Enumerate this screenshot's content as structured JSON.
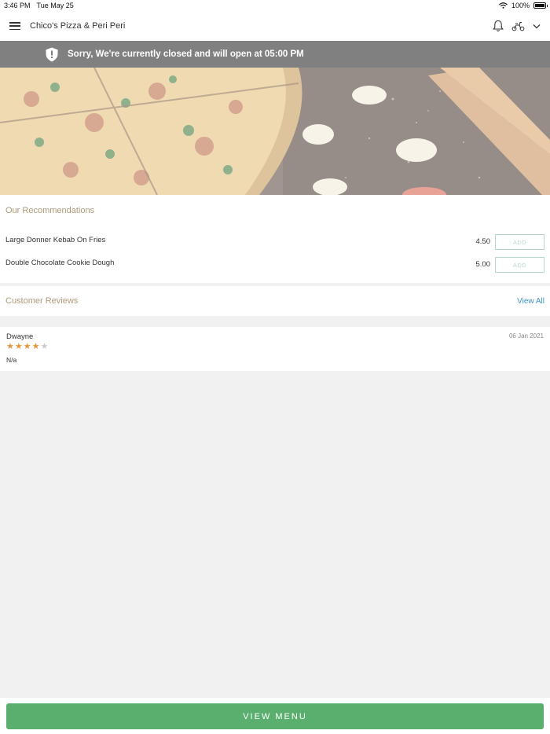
{
  "status_bar": {
    "time": "3:46 PM",
    "date": "Tue May 25",
    "battery": "100%"
  },
  "header": {
    "title": "Chico's Pizza & Peri Peri",
    "icons": [
      "menu-icon",
      "bell-icon",
      "delivery-scooter-icon",
      "chevron-down-icon"
    ]
  },
  "banner": {
    "message": "Sorry, We're currently closed and will open at 05:00 PM",
    "icon": "shield-alert-icon",
    "color": "#808080"
  },
  "recommendations": {
    "title": "Our Recommendations",
    "items": [
      {
        "name": "Large Donner Kebab On Fries",
        "price": "4.50",
        "button": "ADD"
      },
      {
        "name": "Double Chocolate Cookie Dough",
        "price": "5.00",
        "button": "ADD"
      }
    ]
  },
  "reviews": {
    "title": "Customer Reviews",
    "view_all": "View All",
    "items": [
      {
        "reviewer": "Dwayne",
        "date": "06 Jan 2021",
        "rating": 4,
        "max_rating": 5,
        "comment": "N/a"
      }
    ]
  },
  "footer": {
    "button": "VIEW MENU",
    "accent": "#5aae6e"
  }
}
